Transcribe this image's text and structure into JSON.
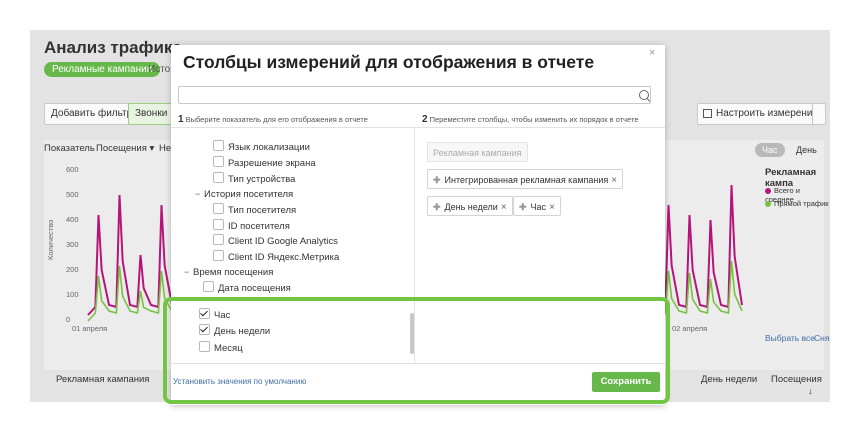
{
  "background": {
    "page_title": "Анализ трафика",
    "tab_active": "Рекламные кампании",
    "tab_next": "Исто",
    "toolbar": {
      "add_filter": "Добавить фильтр",
      "calls": "Звонки",
      "configure": "Настроить измерения"
    },
    "controls": {
      "indicator_label": "Показатель",
      "indicator_value": "Посещения",
      "ne": "Не"
    },
    "segments": {
      "hour": "Час",
      "day": "День"
    },
    "y_axis_label": "Количество",
    "y_ticks": [
      "600",
      "500",
      "400",
      "300",
      "200",
      "100",
      "0"
    ],
    "x_ticks": [
      "01 апреля",
      "02 апреля"
    ],
    "right_panel": {
      "title": "Рекламная кампа",
      "legend": [
        {
          "label": "Всего и среднее",
          "color": "#b5157a"
        },
        {
          "label": "Прямой трафик",
          "color": "#7ac143"
        }
      ],
      "select_all": "Выбрать все",
      "unselect": "Сня"
    },
    "table_header": {
      "campaign": "Рекламная кампания",
      "weekday": "День недели",
      "visits": "Посещения"
    }
  },
  "modal": {
    "title": "Столбцы измерений для отображения в отчете",
    "close_icon": "close-icon",
    "search": {
      "value": "",
      "placeholder": ""
    },
    "col1_number": "1",
    "col1_hint": "Выберите показатель для его отображения в отчете",
    "col2_number": "2",
    "col2_hint": "Переместите столбцы, чтобы изменить их порядок в отчете",
    "tree": [
      {
        "label": "Язык локализации",
        "checked": false
      },
      {
        "label": "Разрешение экрана",
        "checked": false
      },
      {
        "label": "Тип устройства",
        "checked": false
      },
      {
        "label": "История посетителя",
        "group": true
      },
      {
        "label": "Тип посетителя",
        "checked": false
      },
      {
        "label": "ID посетителя",
        "checked": false
      },
      {
        "label": "Client ID Google Analytics",
        "checked": false
      },
      {
        "label": "Client ID Яндекс.Метрика",
        "checked": false
      },
      {
        "label": "Время посещения",
        "group": true
      },
      {
        "label": "Дата посещения",
        "checked": false
      },
      {
        "label": "Час",
        "checked": true
      },
      {
        "label": "День недели",
        "checked": true
      },
      {
        "label": "Месяц",
        "checked": false
      }
    ],
    "chips": [
      {
        "label": "Рекламная кампания",
        "disabled": true
      },
      {
        "label": "Интегрированная рекламная кампания"
      },
      {
        "label": "День недели"
      },
      {
        "label": "Час"
      }
    ],
    "reset_link": "Установить значения по умолчанию",
    "save": "Сохранить"
  },
  "colors": {
    "accent_green": "#66b84a",
    "highlight_green": "#72c644",
    "series_magenta": "#b5157a",
    "series_green": "#7ac143"
  }
}
